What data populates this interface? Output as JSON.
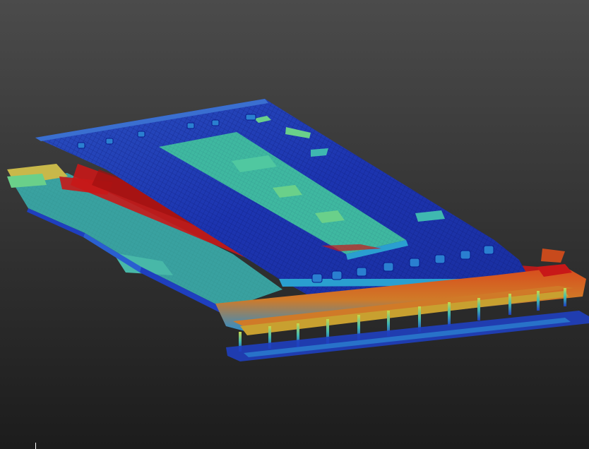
{
  "viewer": {
    "background_top": "#4b4b4b",
    "background_bottom": "#1c1c1c"
  },
  "colormap": [
    "#0a1a8c",
    "#1f3fbf",
    "#2a7fd0",
    "#3fb8b0",
    "#6ad08a",
    "#c8d84a",
    "#e0a030",
    "#d85020",
    "#c81818"
  ],
  "scene": {
    "subject": "point-cloud-building",
    "colored_by": "elevation"
  }
}
